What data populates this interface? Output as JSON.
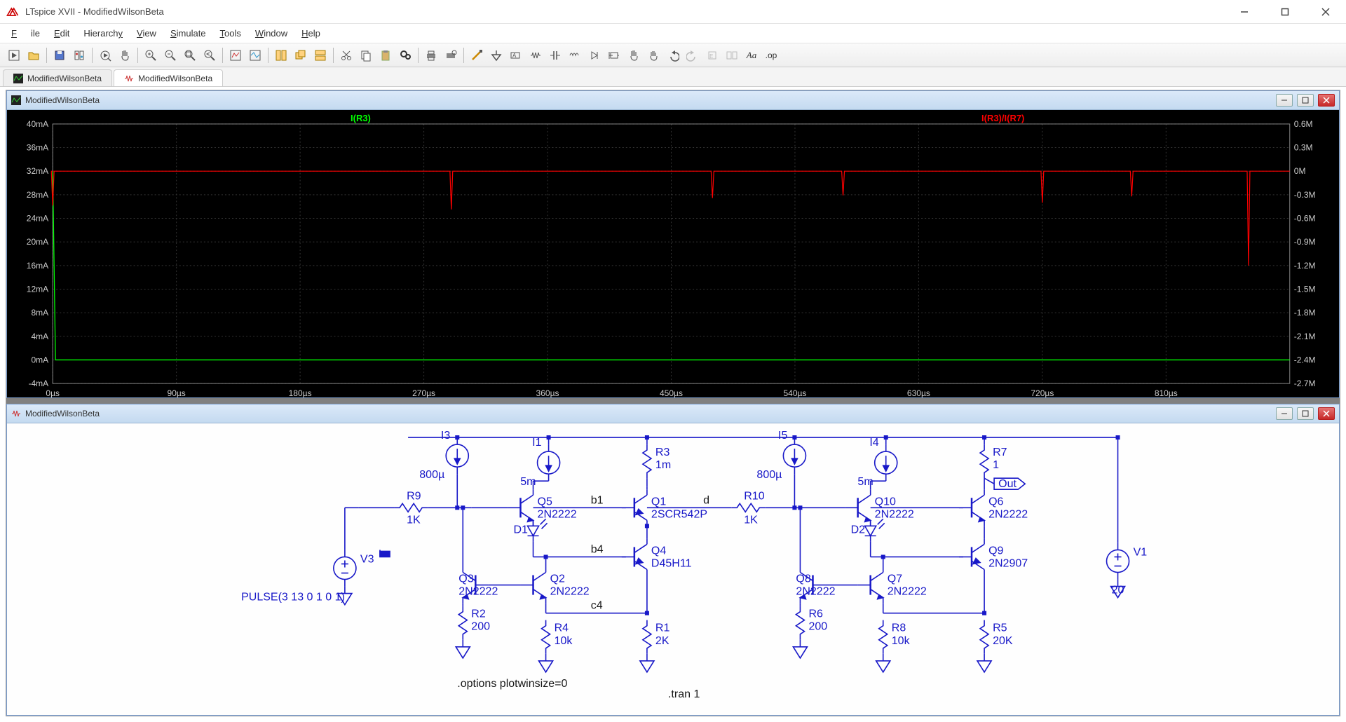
{
  "app": {
    "title": "LTspice XVII - ModifiedWilsonBeta"
  },
  "menu": [
    "File",
    "Edit",
    "Hierarchy",
    "View",
    "Simulate",
    "Tools",
    "Window",
    "Help"
  ],
  "tabs": [
    {
      "label": "ModifiedWilsonBeta",
      "kind": "plot",
      "active": false
    },
    {
      "label": "ModifiedWilsonBeta",
      "kind": "schem",
      "active": true
    }
  ],
  "plot_window": {
    "title": "ModifiedWilsonBeta"
  },
  "schem_window": {
    "title": "ModifiedWilsonBeta"
  },
  "chart_data": {
    "type": "line",
    "title": "",
    "xlabel": "",
    "x_unit": "µs",
    "x_ticks": [
      0,
      90,
      180,
      270,
      360,
      450,
      540,
      630,
      720,
      810
    ],
    "left_y": {
      "label": "I(R3)",
      "unit": "mA",
      "ticks": [
        -4,
        0,
        4,
        8,
        12,
        16,
        20,
        24,
        28,
        32,
        36,
        40
      ],
      "color": "#00ff00"
    },
    "right_y": {
      "label": "I(R3)/I(R7)",
      "unit": "M",
      "ticks": [
        -2.7,
        -2.4,
        -2.1,
        -1.8,
        -1.5,
        -1.2,
        -0.9,
        -0.6,
        -0.3,
        0.0,
        0.3,
        0.6
      ],
      "color": "#ff0000"
    },
    "series": [
      {
        "name": "I(R3)",
        "axis": "left",
        "color": "#00ff00",
        "nominal_value_mA": 0,
        "spike_time_us": 0,
        "spike_value_mA": 32
      },
      {
        "name": "I(R3)/I(R7)",
        "axis": "right",
        "color": "#ff0000",
        "nominal_value_M": 0.0,
        "spikes_time_us": [
          0,
          290,
          480,
          575,
          720,
          785,
          870
        ]
      }
    ],
    "xlim_us": [
      0,
      900
    ]
  },
  "schem": {
    "directives": [
      ".options plotwinsize=0",
      ".tran 1"
    ],
    "net_labels": [
      "b1",
      "b4",
      "c4",
      "d",
      "Out"
    ],
    "components": {
      "V3": {
        "type": "V",
        "value": "PULSE(3 13 0 1 0 1)"
      },
      "V1": {
        "type": "V",
        "value": "20"
      },
      "R9": {
        "type": "R",
        "value": "1K"
      },
      "R10": {
        "type": "R",
        "value": "1K"
      },
      "R2": {
        "type": "R",
        "value": "200"
      },
      "R4": {
        "type": "R",
        "value": "10k"
      },
      "R1": {
        "type": "R",
        "value": "2K"
      },
      "R6": {
        "type": "R",
        "value": "200"
      },
      "R8": {
        "type": "R",
        "value": "10k"
      },
      "R5": {
        "type": "R",
        "value": "20K"
      },
      "R3": {
        "type": "R",
        "value": "1m"
      },
      "R7": {
        "type": "R",
        "value": "1"
      },
      "I3": {
        "type": "I",
        "value": "800µ"
      },
      "I1": {
        "type": "I",
        "value": "5m"
      },
      "I5": {
        "type": "I",
        "value": "800µ"
      },
      "I4": {
        "type": "I",
        "value": "5m"
      },
      "Q5": {
        "type": "NPN",
        "model": "2N2222"
      },
      "Q1": {
        "type": "PNP",
        "model": "2SCR542P"
      },
      "Q4": {
        "type": "PNP",
        "model": "D45H11"
      },
      "Q2": {
        "type": "NPN",
        "model": "2N2222"
      },
      "Q3": {
        "type": "NPN",
        "model": "2N2222"
      },
      "Q10": {
        "type": "NPN",
        "model": "2N2222"
      },
      "Q6": {
        "type": "NPN",
        "model": "2N2222"
      },
      "Q9": {
        "type": "PNP",
        "model": "2N2907"
      },
      "Q7": {
        "type": "NPN",
        "model": "2N2222"
      },
      "Q8": {
        "type": "NPN",
        "model": "2N2222"
      },
      "D1": {
        "type": "LED"
      },
      "D2": {
        "type": "LED"
      }
    }
  }
}
